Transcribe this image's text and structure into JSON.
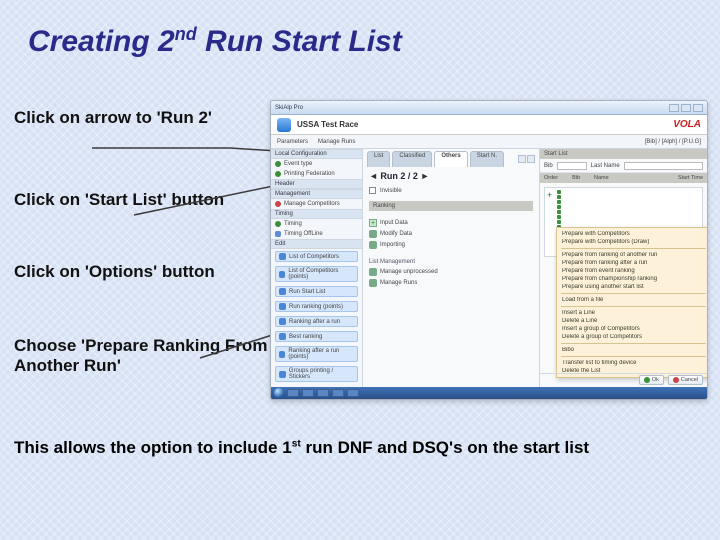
{
  "title": {
    "pre": "Creating 2",
    "sup": "nd",
    "post": " Run Start List"
  },
  "steps": {
    "s1": "Click on arrow to 'Run 2'",
    "s2": "Click on 'Start List' button",
    "s3": "Click on 'Options' button",
    "s4": "Choose 'Prepare Ranking From Another Run'"
  },
  "footer": {
    "pre": "This allows the option to include 1",
    "sup": "st",
    "post": " run DNF and DSQ's on the start list"
  },
  "app": {
    "window_title": "SkiAlp Pro",
    "race_title": "USSA Test Race",
    "vola": "VOLA",
    "menubar": [
      "Parameters",
      "Manage Runs",
      "[Bib] / [Alph] / [P.U.G]"
    ],
    "left_sections": {
      "local": "Local Configuration",
      "event": "Event type",
      "fed": "Printing Federation",
      "header": "Header",
      "mgmt": "Management",
      "mgmt_item": "Manage Competitors",
      "timing": "Timing",
      "timing_item": "Timing",
      "edit": "Edit",
      "bb1": "List of Competitors",
      "bb2": "List of Competitors (points)",
      "bb3": "Run Start List",
      "bb4": "Run ranking (points)",
      "bb5": "Ranking after a run",
      "bb6": "Best ranking",
      "bb7": "Ranking after a run (points)",
      "bb8": "Groups printing / Stickers"
    },
    "mid": {
      "tab_list": "List",
      "tab_classified": "Classified",
      "tab_others": "Others",
      "tab_startnext": "Start N.",
      "run_title": "Run 2 / 2",
      "check1": "Invisible",
      "rank_head": "Ranking",
      "input_data": "Input Data",
      "modify": "Modify Data",
      "importing": "Importing",
      "list_mgmt": "List Management",
      "mgr_processed": "Manage unprocessed",
      "mgr_runs": "Manage Runs"
    },
    "right": {
      "panel": "Start List",
      "bib": "Bib",
      "lastname": "Last Name",
      "col_order": "Order",
      "col_bib": "Bib",
      "col_name": "Name",
      "col_start": "Start Time",
      "ok": "Ok",
      "cancel": "Cancel"
    },
    "dropdown": [
      "Prepare with Competitors",
      "Prepare with Competitors (Draw)",
      "Prepare from ranking of another run",
      "Prepare from ranking after a run",
      "Prepare from event ranking",
      "Prepare from championship ranking",
      "Prepare using another start list",
      "Load from a file",
      "Insert a Line",
      "Delete a Line",
      "Insert a group of Competitors",
      "Delete a group of Competitors",
      "Bibo",
      "Transfer list to timing device",
      "Delete the List"
    ]
  }
}
